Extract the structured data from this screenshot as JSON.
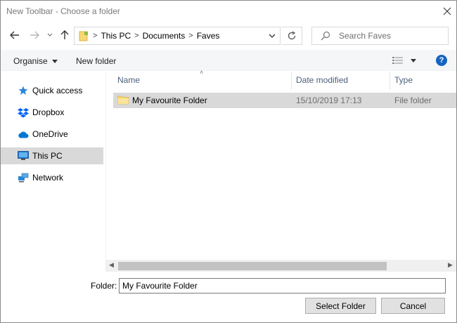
{
  "window": {
    "title": "New Toolbar - Choose a folder"
  },
  "address": {
    "segments": [
      "This PC",
      "Documents",
      "Faves"
    ]
  },
  "search": {
    "placeholder": "Search Faves"
  },
  "toolbar": {
    "organise_label": "Organise",
    "new_folder_label": "New folder"
  },
  "sidebar": {
    "items": [
      {
        "label": "Quick access",
        "icon": "star-icon",
        "color": "#2b88d8"
      },
      {
        "label": "Dropbox",
        "icon": "dropbox-icon",
        "color": "#0061fe"
      },
      {
        "label": "OneDrive",
        "icon": "cloud-icon",
        "color": "#0078d4"
      },
      {
        "label": "This PC",
        "icon": "computer-icon",
        "color": "#1a73c8",
        "selected": true
      },
      {
        "label": "Network",
        "icon": "network-icon",
        "color": "#2b88d8"
      }
    ]
  },
  "columns": {
    "name": "Name",
    "date": "Date modified",
    "type": "Type"
  },
  "files": [
    {
      "name": "My Favourite Folder",
      "date": "15/10/2019 17:13",
      "type": "File folder",
      "selected": true
    }
  ],
  "footer": {
    "folder_label": "Folder:",
    "folder_value": "My Favourite Folder",
    "select_label": "Select Folder",
    "cancel_label": "Cancel"
  },
  "colors": {
    "folder": "#f8d775",
    "help": "#1565c0",
    "selection": "#d9d9d9"
  }
}
